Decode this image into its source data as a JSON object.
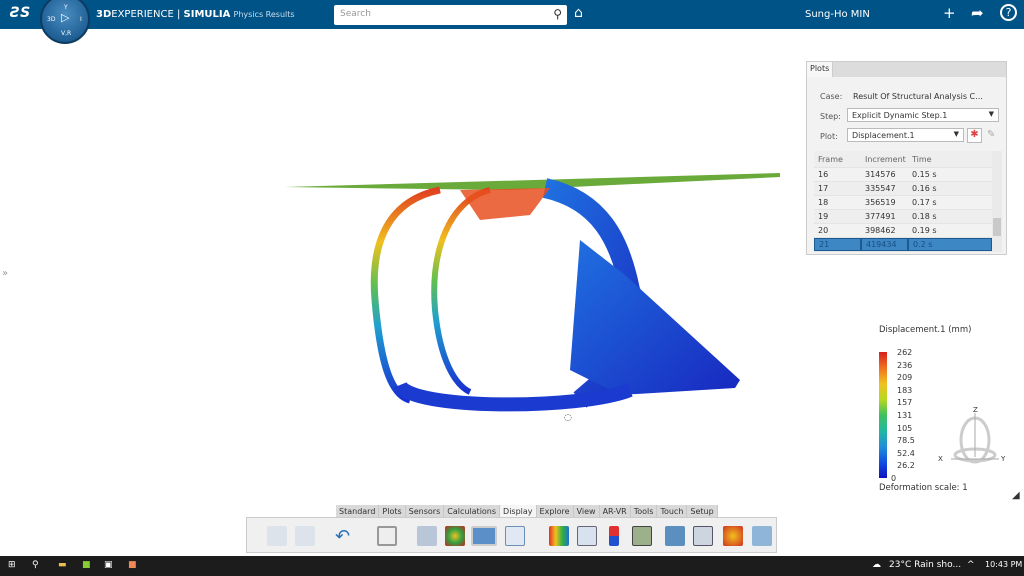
{
  "header": {
    "brand_bold": "3D",
    "brand_rest": "EXPERIENCE | ",
    "product": "SIMULIA",
    "app": "Physics Results",
    "search_placeholder": "Search",
    "user": "Sung-Ho MIN",
    "compass": {
      "top": "Y",
      "left": "3D",
      "right": "I",
      "bottom": "V,R"
    }
  },
  "plots_panel": {
    "tab": "Plots",
    "case_label": "Case:",
    "case_value": "Result Of Structural Analysis C...",
    "step_label": "Step:",
    "step_value": "Explicit Dynamic Step.1",
    "plot_label": "Plot:",
    "plot_value": "Displacement.1",
    "columns": [
      "Frame",
      "Increment",
      "Time"
    ],
    "rows": [
      [
        "16",
        "314576",
        "0.15 s"
      ],
      [
        "17",
        "335547",
        "0.16 s"
      ],
      [
        "18",
        "356519",
        "0.17 s"
      ],
      [
        "19",
        "377491",
        "0.18 s"
      ],
      [
        "20",
        "398462",
        "0.19 s"
      ],
      [
        "21",
        "419434",
        "0.2 s"
      ]
    ],
    "selected_frame": "21"
  },
  "legend": {
    "title": "Displacement.1 (mm)",
    "ticks": [
      "262",
      "236",
      "209",
      "183",
      "157",
      "131",
      "105",
      "78.5",
      "52.4",
      "26.2",
      "0"
    ],
    "deformation": "Deformation scale: 1"
  },
  "axes": {
    "z": "Z",
    "x": "X",
    "y": "Y"
  },
  "tabs": [
    "Standard",
    "Plots",
    "Sensors",
    "Calculations",
    "Display",
    "Explore",
    "View",
    "AR-VR",
    "Tools",
    "Touch",
    "Setup"
  ],
  "active_tab": "Display",
  "taskbar": {
    "weather": "23°C  Rain sho...",
    "time": "10:43 PM"
  }
}
